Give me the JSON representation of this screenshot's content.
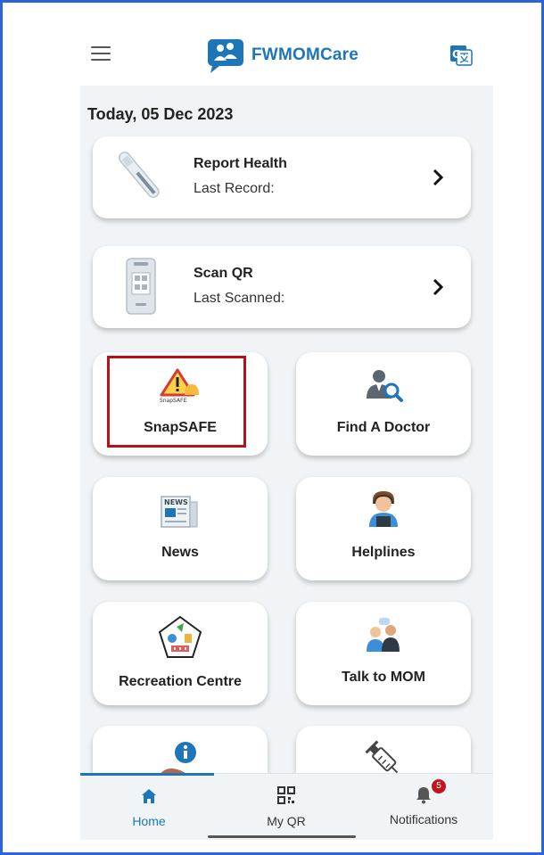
{
  "app": {
    "title": "FWMOMCare"
  },
  "header": {
    "date": "Today, 05 Dec 2023"
  },
  "cards": {
    "report_health": {
      "title": "Report Health",
      "subtitle": "Last Record:"
    },
    "scan_qr": {
      "title": "Scan QR",
      "subtitle": "Last Scanned:"
    }
  },
  "tiles": {
    "snapsafe": {
      "label": "SnapSAFE",
      "icon_text": "SnapSAFE"
    },
    "find_doctor": {
      "label": "Find A Doctor"
    },
    "news": {
      "label": "News",
      "icon_text": "NEWS"
    },
    "helplines": {
      "label": "Helplines"
    },
    "recreation": {
      "label": "Recreation Centre"
    },
    "talk_mom": {
      "label": "Talk to MOM"
    }
  },
  "bottom_nav": {
    "home": "Home",
    "my_qr": "My QR",
    "notifications": "Notifications",
    "notifications_count": "5"
  },
  "colors": {
    "brand": "#1c76b8",
    "highlight": "#b4121b",
    "badge": "#c0161f"
  }
}
